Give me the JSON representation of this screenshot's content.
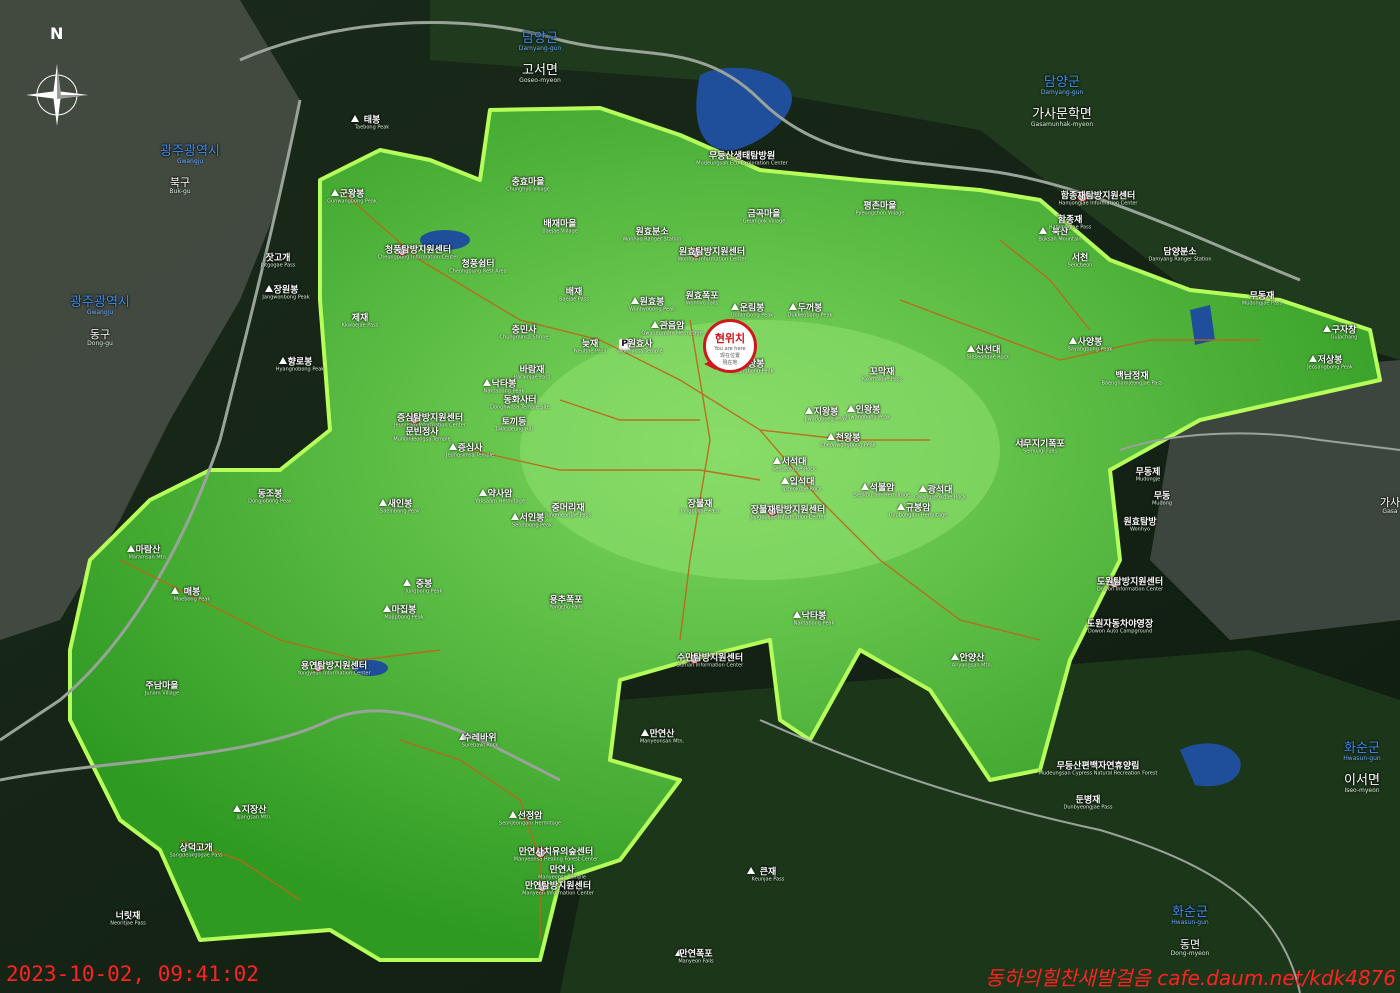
{
  "overlay": {
    "timestamp": "2023-10-02, 09:41:02",
    "watermark": "동하의힐찬새발걸음 cafe.daum.net/kdk4876"
  },
  "compass": {
    "north_label": "N",
    "icon": "compass-rose-icon"
  },
  "you_are_here": {
    "ko": "현위치",
    "en": "You are here",
    "cn": "现在位置",
    "jp": "現在地"
  },
  "colors": {
    "park_area": "#3fa62a",
    "park_border": "#b6ff5a",
    "water": "#1f4f9a",
    "marker_red": "#d0181c",
    "trail": "#c0641c"
  },
  "regions": [
    {
      "ko": "담양군",
      "en": "Damyang-gun"
    },
    {
      "ko": "고서면",
      "en": "Goseo-myeon"
    },
    {
      "ko": "담양군",
      "en": "Damyang-gun"
    },
    {
      "ko": "가사문학면",
      "en": "Gasamunhak-myeon"
    },
    {
      "ko": "광주광역시",
      "en": "Gwangju"
    },
    {
      "ko": "북구",
      "en": "Buk-gu"
    },
    {
      "ko": "광주광역시",
      "en": "Gwangju"
    },
    {
      "ko": "동구",
      "en": "Dong-gu"
    },
    {
      "ko": "화순군",
      "en": "Hwasun-gun"
    },
    {
      "ko": "이서면",
      "en": "Iseo-myeon"
    },
    {
      "ko": "화순군",
      "en": "Hwasun-gun"
    },
    {
      "ko": "동면",
      "en": "Dong-myeon"
    },
    {
      "ko": "가사",
      "en": "Gasa"
    }
  ],
  "places": [
    {
      "ko": "태봉",
      "en": "Taebong Peak"
    },
    {
      "ko": "군왕봉",
      "en": "Gunwangbong Peak"
    },
    {
      "ko": "잣고개",
      "en": "Jatgogae Pass"
    },
    {
      "ko": "장원봉",
      "en": "Jangwonbong Peak"
    },
    {
      "ko": "제재",
      "en": "Kkwaejae Pass"
    },
    {
      "ko": "향로봉",
      "en": "Hyangnobong Peak"
    },
    {
      "ko": "청풍탐방지원센터",
      "en": "Cheongpung Information Center"
    },
    {
      "ko": "청풍쉼터",
      "en": "Cheongpung Rest Area"
    },
    {
      "ko": "충효마을",
      "en": "Chunghyo Village"
    },
    {
      "ko": "배재마을",
      "en": "Baejae Village"
    },
    {
      "ko": "원효분소",
      "en": "Wonhyo Ranger Station"
    },
    {
      "ko": "금곡마을",
      "en": "Geumgok Village"
    },
    {
      "ko": "평촌마을",
      "en": "Pyeongchon Village"
    },
    {
      "ko": "무등산생태탐방원",
      "en": "Mudeungsan Eco-Exploration Center"
    },
    {
      "ko": "원효탐방지원센터",
      "en": "Wonhyo Information Center"
    },
    {
      "ko": "배재",
      "en": "Baejae Pass"
    },
    {
      "ko": "원효봉",
      "en": "Wonhyobong Peak"
    },
    {
      "ko": "원효폭포",
      "en": "Wonhyo Falls"
    },
    {
      "ko": "운림봉",
      "en": "Unnimbong Peak"
    },
    {
      "ko": "두꺼봉",
      "en": "Dukkeobong Peak"
    },
    {
      "ko": "관음암",
      "en": "Gwaneumam Hermitage"
    },
    {
      "ko": "원효사",
      "en": "Wonhyosa Temple"
    },
    {
      "ko": "의상봉",
      "en": "Uisangbong Peak"
    },
    {
      "ko": "늦재",
      "en": "Neutjae Pass"
    },
    {
      "ko": "바람재",
      "en": "Baramjae Pass"
    },
    {
      "ko": "토끼등",
      "en": "Tokkideung Hill"
    },
    {
      "ko": "동화사터",
      "en": "Donghwasa Temple Site"
    },
    {
      "ko": "충민사",
      "en": "Chungminsa Shrine"
    },
    {
      "ko": "낙타봉",
      "en": "Naktabong Peak"
    },
    {
      "ko": "증심탐방지원센터",
      "en": "Jeungsim Information Center"
    },
    {
      "ko": "문빈정사",
      "en": "Munbinjeongsa Temple"
    },
    {
      "ko": "증심사",
      "en": "Jeungsimsa Temple"
    },
    {
      "ko": "약사암",
      "en": "Yaksaam Hermitage"
    },
    {
      "ko": "중머리재",
      "en": "Jungmeorijae Pass"
    },
    {
      "ko": "서인봉",
      "en": "Seoinbong Peak"
    },
    {
      "ko": "새인봉",
      "en": "Saeinbong Peak"
    },
    {
      "ko": "장불재",
      "en": "Jangbuljae Pass"
    },
    {
      "ko": "장불재탐방지원센터",
      "en": "Jangbuljae Information Center"
    },
    {
      "ko": "입석대",
      "en": "Ipseokdae Rock"
    },
    {
      "ko": "서석대",
      "en": "Seoseokdae Rock"
    },
    {
      "ko": "천왕봉",
      "en": "Cheonwangbong Peak"
    },
    {
      "ko": "지왕봉",
      "en": "Jiwangbong Peak"
    },
    {
      "ko": "인왕봉",
      "en": "Inwangbong Peak"
    },
    {
      "ko": "규봉암",
      "en": "Gyubongam Hermitage"
    },
    {
      "ko": "광석대",
      "en": "Gwangseokdae Rock"
    },
    {
      "ko": "석불암",
      "en": "Seokburam Hermitage"
    },
    {
      "ko": "서무지기폭포",
      "en": "Semujigi Falls"
    },
    {
      "ko": "꼬막재",
      "en": "Kkomakjae Pass"
    },
    {
      "ko": "신선대",
      "en": "Sinseondae Rock"
    },
    {
      "ko": "북산",
      "en": "Buksan Mountain"
    },
    {
      "ko": "백남정재",
      "en": "Baengnamjeongjae Pass"
    },
    {
      "ko": "사양봉",
      "en": "Sayangbong Peak"
    },
    {
      "ko": "무동재",
      "en": "Mudongjae Pass"
    },
    {
      "ko": "구자창",
      "en": "Gujachang"
    },
    {
      "ko": "저상봉",
      "en": "Jeosangbong Peak"
    },
    {
      "ko": "담양분소",
      "en": "Damyang Ranger Station"
    },
    {
      "ko": "함종재탐방지원센터",
      "en": "Hamjongjae Information Center"
    },
    {
      "ko": "함종재",
      "en": "Hamjongjae Pass"
    },
    {
      "ko": "서천",
      "en": "Seocheon"
    },
    {
      "ko": "무동제",
      "en": "Mudongje"
    },
    {
      "ko": "무동",
      "en": "Mudong"
    },
    {
      "ko": "원효탐방",
      "en": "Wonhyo"
    },
    {
      "ko": "도원탐방지원센터",
      "en": "Dowon Information Center"
    },
    {
      "ko": "도원자동차야영장",
      "en": "Dowon Auto Campground"
    },
    {
      "ko": "안양산",
      "en": "Anyangsan Mtn."
    },
    {
      "ko": "낙타봉",
      "en": "Naktabong Peak"
    },
    {
      "ko": "용추폭포",
      "en": "Yongchu Falls"
    },
    {
      "ko": "수만탐방지원센터",
      "en": "Suman Information Center"
    },
    {
      "ko": "마집봉",
      "en": "Majipbong Peak"
    },
    {
      "ko": "중봉",
      "en": "Jungbong Peak"
    },
    {
      "ko": "동조봉",
      "en": "Dongjobong Peak"
    },
    {
      "ko": "매봉",
      "en": "Maebong Peak"
    },
    {
      "ko": "마람산",
      "en": "Maramsan Mtn."
    },
    {
      "ko": "용연탐방지원센터",
      "en": "Yongyeon Information Center"
    },
    {
      "ko": "주남마을",
      "en": "Junam Village"
    },
    {
      "ko": "수레바위",
      "en": "Surebawi Rock"
    },
    {
      "ko": "지장산",
      "en": "Jijangsan Mtn."
    },
    {
      "ko": "상덕고개",
      "en": "Sangdeokgogae Pass"
    },
    {
      "ko": "너릿재",
      "en": "Neoritjae Pass"
    },
    {
      "ko": "선정암",
      "en": "Seonjeongam Hermitage"
    },
    {
      "ko": "만연사치유의숲센터",
      "en": "Manyeonsa Healing Forest Center"
    },
    {
      "ko": "만연사",
      "en": "Manyeonsa Temple"
    },
    {
      "ko": "만연탐방지원센터",
      "en": "Manyeon Information Center"
    },
    {
      "ko": "만연산",
      "en": "Manyeonsan Mtn."
    },
    {
      "ko": "큰재",
      "en": "Keunjae Pass"
    },
    {
      "ko": "만연폭포",
      "en": "Manyeon Falls"
    },
    {
      "ko": "무등산편백자연휴양림",
      "en": "Mudeungsan Cypress Natural Recreation Forest"
    },
    {
      "ko": "둔병재",
      "en": "Dunbyeongjae Pass"
    }
  ]
}
